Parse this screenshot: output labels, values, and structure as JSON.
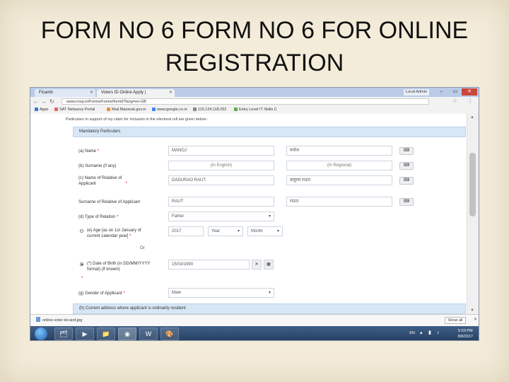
{
  "slide": {
    "title": "FORM NO 6 FORM NO 6 FOR ONLINE REGISTRATION"
  },
  "browser": {
    "tabs": [
      {
        "label": "Ficamb"
      },
      {
        "label": "Voters ID Online Apply |"
      }
    ],
    "user_badge": "Local Admin",
    "address": "www.nvsp.in/Forms/Forms/form6?lang=en-GB",
    "bookmarks": [
      {
        "label": "Apps",
        "icon": "apps-icon",
        "color": "#3c78d8"
      },
      {
        "label": "SAT Netsavvy Portal",
        "icon": "page-icon",
        "color": "#e06666"
      },
      {
        "label": "Mail.Manavat.gov.in",
        "icon": "page-icon",
        "color": "#e69138"
      },
      {
        "label": "www.google.co.in",
        "icon": "google-icon",
        "color": "#4285f4"
      },
      {
        "label": "115.124.118.252",
        "icon": "page-icon",
        "color": "#888888"
      },
      {
        "label": "Entry Level IT Skills C",
        "icon": "page-icon",
        "color": "#6aa84f"
      }
    ]
  },
  "form": {
    "intro_text": "Particulars in support of my claim for inclusion in the electoral roll are given below:-",
    "panel_mandatory": "Mandatory Particulars",
    "name": {
      "label": "(a) Name",
      "value": "MANOJ",
      "regional": "मनोज"
    },
    "surname": {
      "label": "(b) Surname (if any)",
      "english_placeholder": "(In English)",
      "regional_placeholder": "(In Regional)"
    },
    "relative": {
      "label_line1": "(c) Name of Relative of",
      "label_line2": "Applicant",
      "value": "DADURAO RAUT",
      "regional": "दादूराव राऊत"
    },
    "relative_surname": {
      "label": "Surname of Relative of Applicant",
      "value": "RAUT",
      "regional": "राऊत"
    },
    "relation": {
      "label": "(d) Type of Relation",
      "value": "Father"
    },
    "age": {
      "label_line1": "(e) Age [as on 1st January of",
      "label_line2": "current calendar year]",
      "year": "2017",
      "year_placeholder": "Year",
      "month_placeholder": "Month"
    },
    "or_text": "Or",
    "dob": {
      "label_line1": "(*) Date of Birth (in DD/MM/YYYY",
      "label_line2": "format) (if known)",
      "value": "15/03/1990"
    },
    "gender": {
      "label": "(g) Gender of Applicant",
      "value": "Male"
    },
    "panel_address": "(h) Current address where applicant is ordinarily resident",
    "keyboard_symbol": "⌨"
  },
  "downloads": {
    "file": "online-voter-id-card.jpg",
    "show_all": "Show all"
  },
  "taskbar": {
    "lang": "EN",
    "time": "5:03 PM",
    "date": "8/8/2017"
  }
}
